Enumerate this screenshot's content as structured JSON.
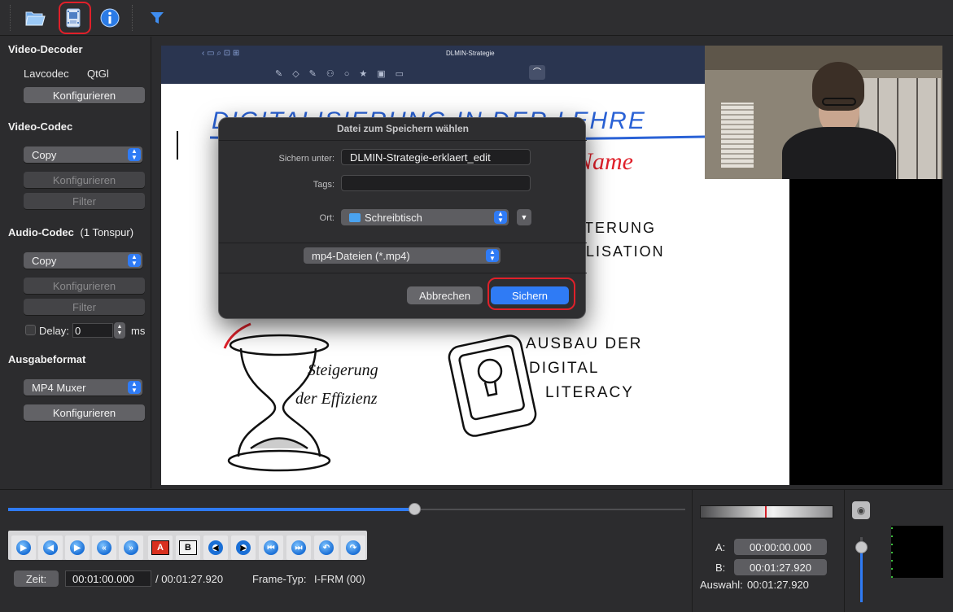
{
  "toolbar": {
    "items": [
      "open-file",
      "save-video",
      "info",
      "filter"
    ]
  },
  "left_panel": {
    "video_decoder": {
      "title": "Video-Decoder",
      "decoder": "Lavcodec",
      "renderer": "QtGl",
      "configure": "Konfigurieren"
    },
    "video_codec": {
      "title": "Video-Codec",
      "selected": "Copy",
      "configure": "Konfigurieren",
      "filter": "Filter"
    },
    "audio_codec": {
      "title": "Audio-Codec",
      "tracks": "(1 Tonspur)",
      "selected": "Copy",
      "configure": "Konfigurieren",
      "filter": "Filter",
      "delay_label": "Delay:",
      "delay_value": "0",
      "delay_unit": "ms"
    },
    "output_format": {
      "title": "Ausgabeformat",
      "selected": "MP4 Muxer",
      "configure": "Konfigurieren"
    }
  },
  "video": {
    "app_title": "DLMIN-Strategie",
    "board_heading": "Digitalisierung in der Lehre",
    "annotation": "Name",
    "sketch_texts": {
      "steigerung": [
        "Steigerung",
        "der Effizienz"
      ],
      "ausbau": [
        "Ausbau der",
        "Digital",
        "Literacy"
      ],
      "partial": [
        "…terung",
        "…lisation"
      ]
    }
  },
  "dialog": {
    "title": "Datei zum Speichern wählen",
    "save_as_label": "Sichern unter:",
    "filename": "DLMIN-Strategie-erklaert_edit",
    "tags_label": "Tags:",
    "location_label": "Ort:",
    "location": "Schreibtisch",
    "filetype": "mp4-Dateien (*.mp4)",
    "cancel": "Abbrechen",
    "save": "Sichern"
  },
  "bottom": {
    "progress": 0.6,
    "time_label": "Zeit:",
    "current_time": "00:01:00.000",
    "total_time": "/ 00:01:27.920",
    "frame_type_label": "Frame-Typ:",
    "frame_type": "I-FRM (00)",
    "a_label": "A:",
    "a_value": "00:00:00.000",
    "b_label": "B:",
    "b_value": "00:01:27.920",
    "selection_label": "Auswahl:",
    "selection_value": "00:01:27.920",
    "volume": 0.85,
    "nav_buttons": [
      "play",
      "prev-frame",
      "next-frame",
      "prev-keyframe",
      "next-keyframe",
      "set-marker-a",
      "set-marker-b",
      "prev-black",
      "next-black",
      "goto-first",
      "goto-last",
      "back-60",
      "forward-60"
    ]
  },
  "colors": {
    "accent_blue": "#2f7bf5",
    "annotation_red": "#e0202a",
    "panel_bg": "#2c2c2e"
  }
}
